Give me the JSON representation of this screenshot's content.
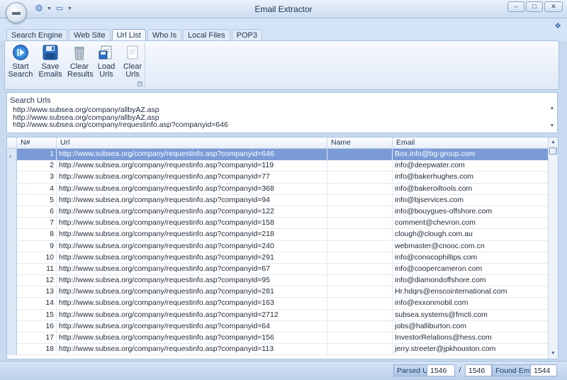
{
  "window": {
    "title": "Email Extractor",
    "controls": [
      "–",
      "□",
      "✕"
    ]
  },
  "tabs": [
    {
      "label": "Search Engine",
      "active": false
    },
    {
      "label": "Web Site",
      "active": false
    },
    {
      "label": "Url List",
      "active": true
    },
    {
      "label": "Who Is",
      "active": false
    },
    {
      "label": "Local Files",
      "active": false
    },
    {
      "label": "POP3",
      "active": false
    }
  ],
  "ribbon": {
    "buttons": [
      {
        "label_line1": "Start",
        "label_line2": "Search",
        "icon": "play-icon"
      },
      {
        "label_line1": "Save Emails",
        "label_line2": "",
        "icon": "floppy-disk-icon"
      },
      {
        "label_line1": "Clear",
        "label_line2": "Results",
        "icon": "trash-icon"
      },
      {
        "label_line1": "Load Urls",
        "label_line2": "",
        "icon": "load-urls-icon"
      },
      {
        "label_line1": "Clear",
        "label_line2": "Urls",
        "icon": "clear-urls-icon"
      }
    ]
  },
  "search_urls": {
    "label": "Search Urls",
    "lines": [
      "http://www.subsea.org/company/allbyAZ.asp",
      "http://www.subsea.org/company/allbyAZ.asp",
      "http://www.subsea.org/company/requestinfo.asp?companyid=646"
    ]
  },
  "grid": {
    "columns": [
      "N#",
      "Url",
      "Name",
      "Email"
    ],
    "rows": [
      {
        "n": "1",
        "url": "http://www.subsea.org/company/requestinfo.asp?companyid=646",
        "name": "",
        "email": "Box.info@bg-group.com",
        "selected": true
      },
      {
        "n": "2",
        "url": "http://www.subsea.org/company/requestinfo.asp?companyid=119",
        "name": "",
        "email": "info@deepwater.com"
      },
      {
        "n": "3",
        "url": "http://www.subsea.org/company/requestinfo.asp?companyid=77",
        "name": "",
        "email": "info@bakerhughes.com"
      },
      {
        "n": "4",
        "url": "http://www.subsea.org/company/requestinfo.asp?companyid=368",
        "name": "",
        "email": "info@bakeroiltools.com"
      },
      {
        "n": "5",
        "url": "http://www.subsea.org/company/requestinfo.asp?companyid=94",
        "name": "",
        "email": "info@bjservices.com"
      },
      {
        "n": "6",
        "url": "http://www.subsea.org/company/requestinfo.asp?companyid=122",
        "name": "",
        "email": "info@bouygues-offshore.com"
      },
      {
        "n": "7",
        "url": "http://www.subsea.org/company/requestinfo.asp?companyid=158",
        "name": "",
        "email": "comment@chevron.com"
      },
      {
        "n": "8",
        "url": "http://www.subsea.org/company/requestinfo.asp?companyid=218",
        "name": "",
        "email": "clough@clough.com.au"
      },
      {
        "n": "9",
        "url": "http://www.subsea.org/company/requestinfo.asp?companyid=240",
        "name": "",
        "email": "webmaster@cnooc.com.cn"
      },
      {
        "n": "10",
        "url": "http://www.subsea.org/company/requestinfo.asp?companyid=291",
        "name": "",
        "email": "info@conocophillips.com"
      },
      {
        "n": "11",
        "url": "http://www.subsea.org/company/requestinfo.asp?companyid=67",
        "name": "",
        "email": "info@coopercameron.com"
      },
      {
        "n": "12",
        "url": "http://www.subsea.org/company/requestinfo.asp?companyid=95",
        "name": "",
        "email": "info@diamondoffshore.com"
      },
      {
        "n": "13",
        "url": "http://www.subsea.org/company/requestinfo.asp?companyid=281",
        "name": "",
        "email": "Hr.hdqrs@enscointernational.com"
      },
      {
        "n": "14",
        "url": "http://www.subsea.org/company/requestinfo.asp?companyid=163",
        "name": "",
        "email": "info@exxonmobil.com"
      },
      {
        "n": "15",
        "url": "http://www.subsea.org/company/requestinfo.asp?companyid=2712",
        "name": "",
        "email": "subsea.systems@fmcti.com"
      },
      {
        "n": "16",
        "url": "http://www.subsea.org/company/requestinfo.asp?companyid=64",
        "name": "",
        "email": "jobs@halliburton.com"
      },
      {
        "n": "17",
        "url": "http://www.subsea.org/company/requestinfo.asp?companyid=156",
        "name": "",
        "email": "InvestorRelations@hess.com"
      },
      {
        "n": "18",
        "url": "http://www.subsea.org/company/requestinfo.asp?companyid=113",
        "name": "",
        "email": "jerry.streeter@jpkhouston.com"
      }
    ]
  },
  "status": {
    "parsed_label": "Parsed Urls",
    "parsed_value": "1546",
    "separator": "/",
    "total_value": "1546",
    "found_label": "Found Emails",
    "found_value": "1544"
  },
  "colors": {
    "accent": "#2f6cc4",
    "selection": "#7b9bd6",
    "chrome": "#c9daf0"
  }
}
